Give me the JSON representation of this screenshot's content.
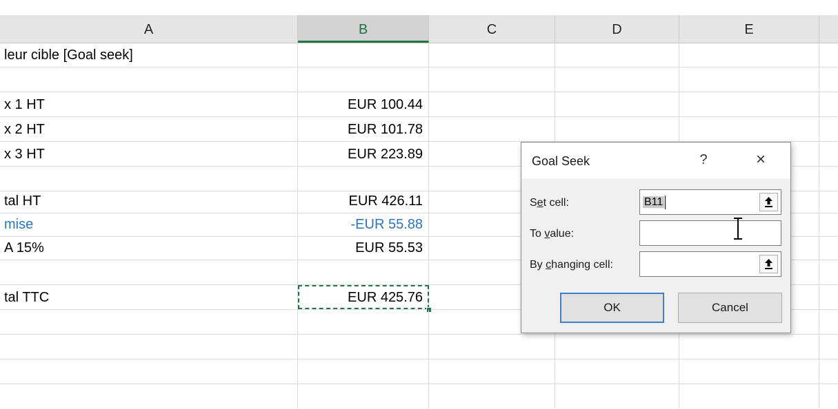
{
  "columns": [
    "A",
    "B",
    "C",
    "D",
    "E"
  ],
  "rows": [
    {
      "a": "leur cible [Goal seek]",
      "b": ""
    },
    {
      "a": "",
      "b": ""
    },
    {
      "a": "x 1 HT",
      "b": "EUR 100.44"
    },
    {
      "a": "x 2 HT",
      "b": "EUR 101.78"
    },
    {
      "a": "x 3 HT",
      "b": "EUR 223.89"
    },
    {
      "a": "",
      "b": ""
    },
    {
      "a": "tal HT",
      "b": "EUR 426.11"
    },
    {
      "a": "mise",
      "b": "-EUR 55.88"
    },
    {
      "a": "A 15%",
      "b": "EUR 55.53"
    },
    {
      "a": "",
      "b": ""
    },
    {
      "a": "tal TTC",
      "b": "EUR 425.76"
    },
    {
      "a": "",
      "b": ""
    },
    {
      "a": "",
      "b": ""
    },
    {
      "a": "",
      "b": ""
    }
  ],
  "colors": {
    "accent": "#217346",
    "blue_text": "#2e75b6",
    "default_button_border": "#3c7fcf"
  },
  "dialog": {
    "title": "Goal Seek",
    "help": "?",
    "close": "×",
    "set_cell_label": "Set cell:",
    "set_cell_value": "B11",
    "to_value_label": "To value:",
    "to_value_value": "",
    "by_changing_label": "By changing cell:",
    "by_changing_value": "",
    "ok_label": "OK",
    "cancel_label": "Cancel",
    "collapse_icon": "range-collapse-icon"
  }
}
